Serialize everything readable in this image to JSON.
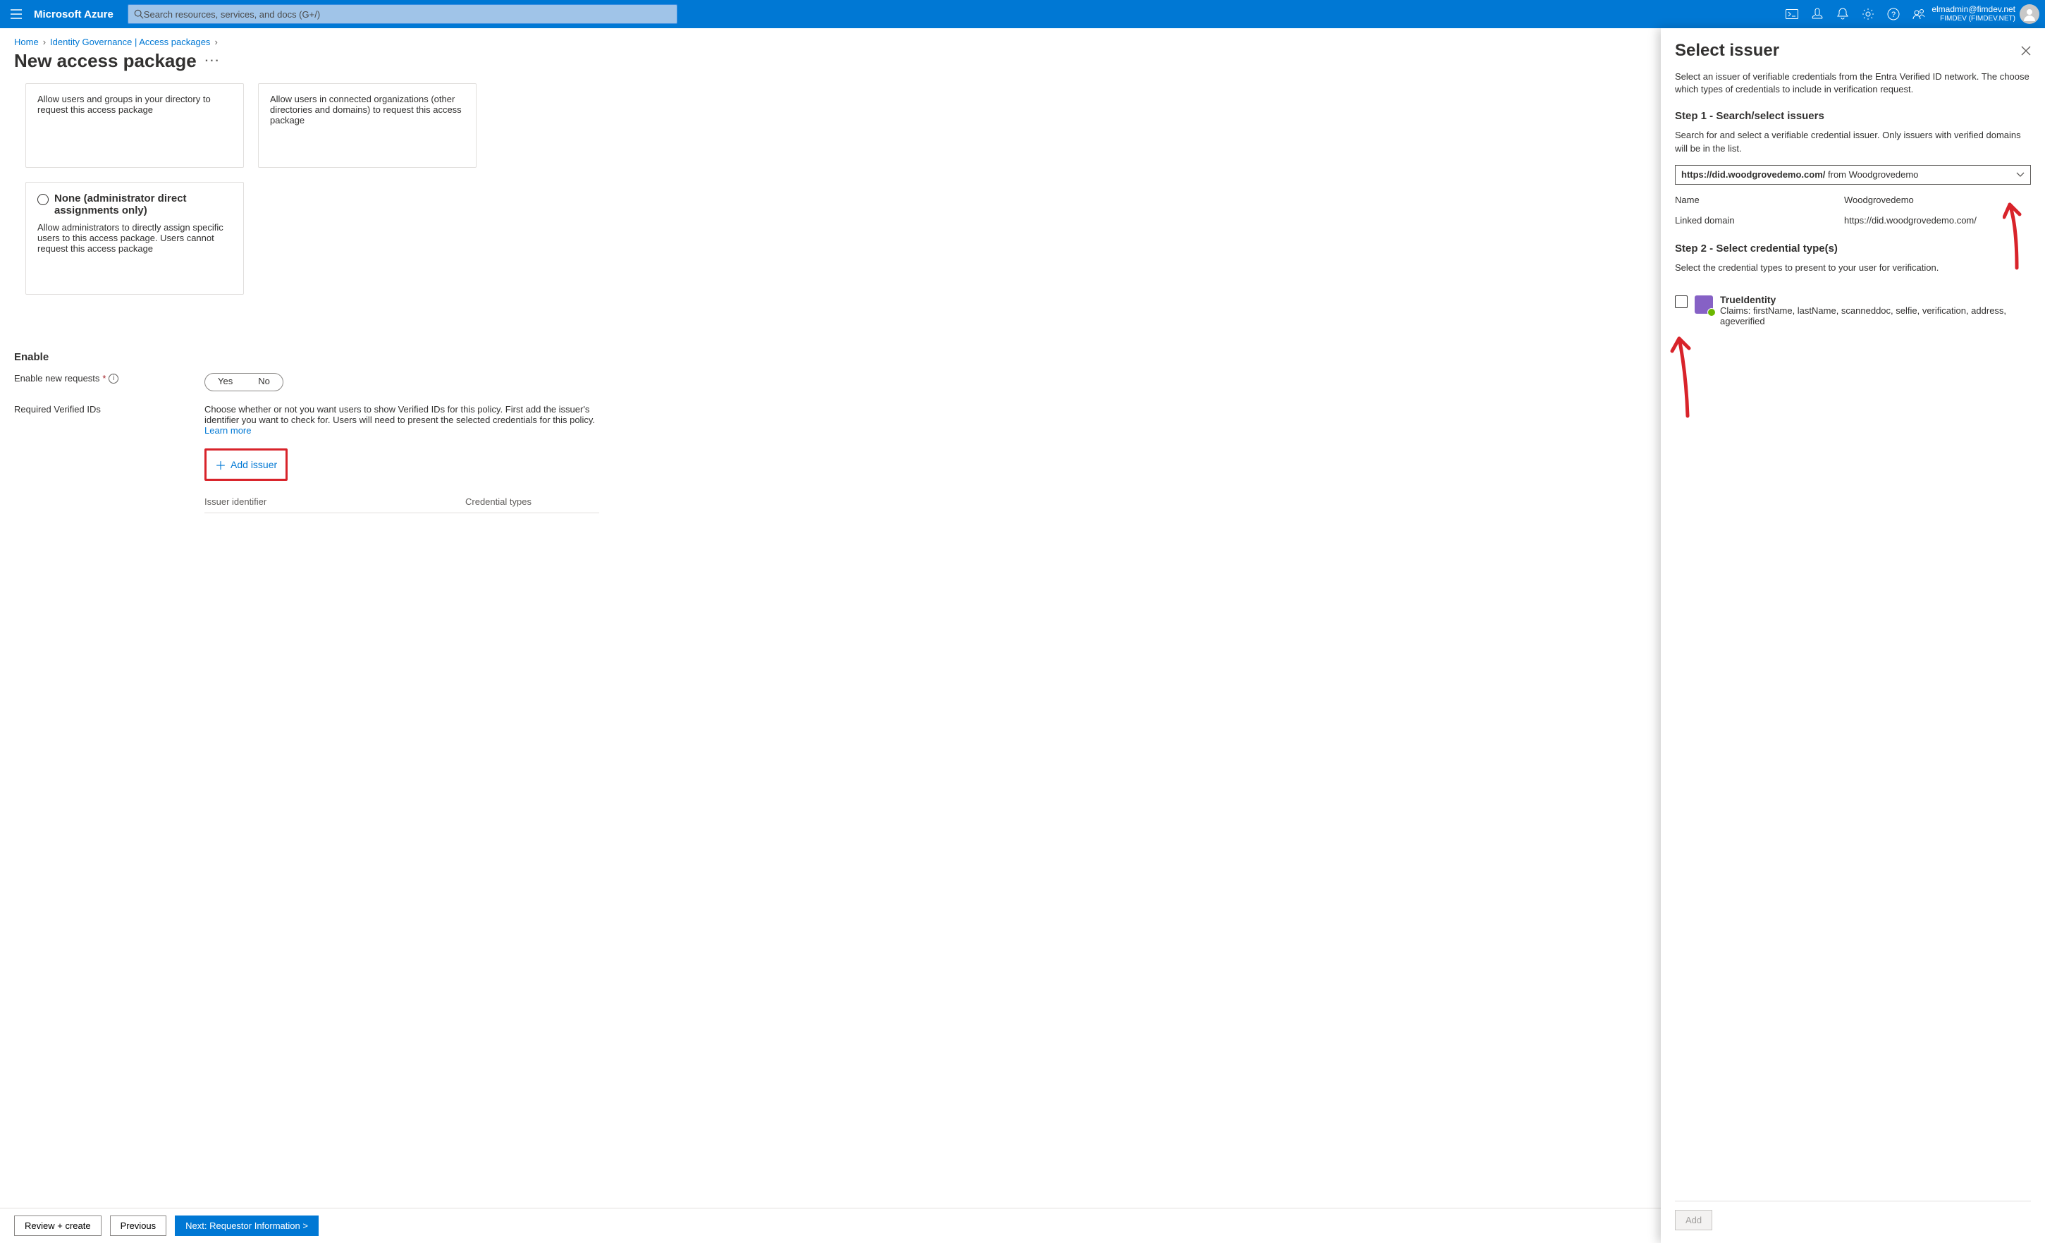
{
  "topbar": {
    "brand": "Microsoft Azure",
    "search_placeholder": "Search resources, services, and docs (G+/)",
    "account_email": "elmadmin@fimdev.net",
    "account_tenant": "FIMDEV (FIMDEV.NET)"
  },
  "breadcrumbs": {
    "home": "Home",
    "governance": "Identity Governance | Access packages"
  },
  "page": {
    "title": "New access package"
  },
  "cards": {
    "c1": "Allow users and groups in your directory to request this access package",
    "c2": "Allow users in connected organizations (other directories and domains) to request this access package",
    "c3_title": "None (administrator direct assignments only)",
    "c3_body": "Allow administrators to directly assign specific users to this access package. Users cannot request this access package"
  },
  "enable": {
    "heading": "Enable",
    "row1_label": "Enable new requests",
    "yes": "Yes",
    "no": "No",
    "row2_label": "Required Verified IDs",
    "row2_help": "Choose whether or not you want users to show Verified IDs for this policy. First add the issuer's identifier you want to check for. Users will need to present the selected credentials for this policy. ",
    "learn_more": "Learn more",
    "add_issuer": "Add issuer",
    "col1": "Issuer identifier",
    "col2": "Credential types"
  },
  "footer": {
    "review": "Review + create",
    "previous": "Previous",
    "next": "Next: Requestor Information >"
  },
  "panel": {
    "title": "Select issuer",
    "intro": "Select an issuer of verifiable credentials from the Entra Verified ID network. The choose which types of credentials to include in verification request.",
    "step1_h": "Step 1 - Search/select issuers",
    "step1_p": "Search for and select a verifiable credential issuer. Only issuers with verified domains will be in the list.",
    "dropdown_url": "https://did.woodgrovedemo.com/",
    "dropdown_from": " from  Woodgrovedemo",
    "name_label": "Name",
    "name_value": "Woodgrovedemo",
    "domain_label": "Linked domain",
    "domain_value": "https://did.woodgrovedemo.com/",
    "step2_h": "Step 2 - Select credential type(s)",
    "step2_p": "Select the credential types to present to your user for verification.",
    "cred_name": "TrueIdentity",
    "cred_claims": "Claims: firstName, lastName, scanneddoc, selfie, verification, address, ageverified",
    "add": "Add"
  }
}
